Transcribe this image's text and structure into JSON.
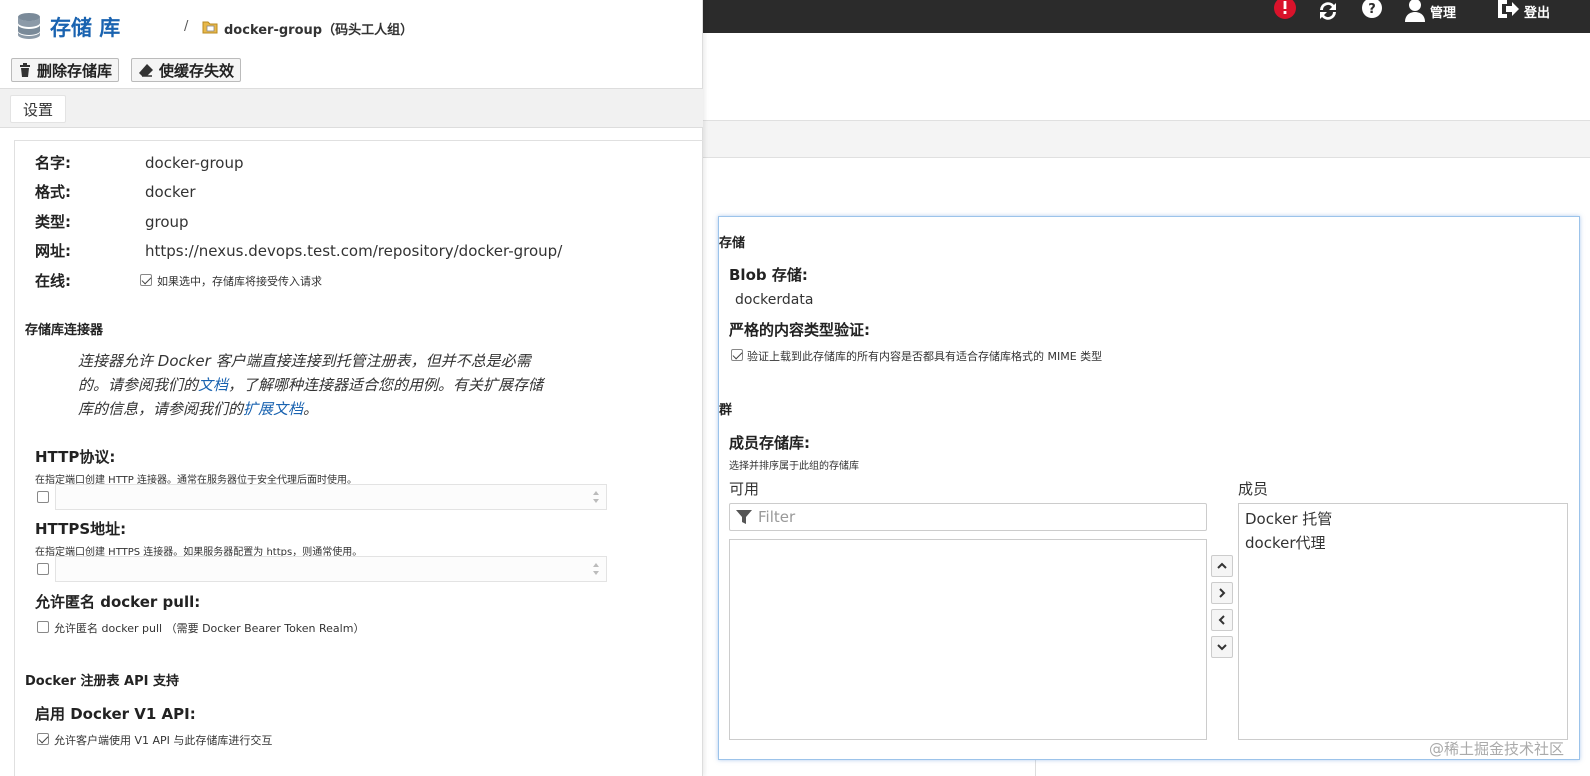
{
  "topbar": {
    "admin_label": "管理",
    "logout_label": "登出"
  },
  "header": {
    "app_title": "存储 库",
    "separator": "/",
    "repo_breadcrumb": "docker-group（码头工人组）"
  },
  "toolbar": {
    "delete_label": "删除存储库",
    "invalidate_label": "使缓存失效"
  },
  "tabs": {
    "settings": "设置"
  },
  "settings": {
    "name_label": "名字:",
    "name_value": "docker-group",
    "format_label": "格式:",
    "format_value": "docker",
    "type_label": "类型:",
    "type_value": "group",
    "url_label": "网址:",
    "url_value": "https://nexus.devops.test.com/repository/docker-group/",
    "online_label": "在线:",
    "online_checked": true,
    "online_text": "如果选中，存储库将接受传入请求"
  },
  "connectors": {
    "title": "存储库连接器",
    "para_1": "连接器允许 Docker 客户端直接连接到托管注册表，但并不总是必需的。请参阅我们的",
    "link_docs": "文档",
    "para_2": "，了解哪种连接器适合您的用例。有关扩展存储库的信息，请参阅我们的",
    "link_ext_docs": "扩展文档",
    "para_3": "。",
    "http_label": "HTTP协议:",
    "http_help": "在指定端口创建 HTTP 连接器。通常在服务器位于安全代理后面时使用。",
    "http_checked": false,
    "https_label": "HTTPS地址:",
    "https_help": "在指定端口创建 HTTPS 连接器。如果服务器配置为 https，则通常使用。",
    "https_checked": false,
    "anon_label": "允许匿名 docker pull:",
    "anon_checked": false,
    "anon_text": "允许匿名 docker pull （需要 Docker Bearer Token Realm）"
  },
  "registry_api": {
    "title": "Docker 注册表 API 支持",
    "v1_label": "启用 Docker V1 API:",
    "v1_checked": true,
    "v1_text": "允许客户端使用 V1 API 与此存储库进行交互"
  },
  "storage": {
    "title": "存储",
    "blob_label": "Blob 存储:",
    "blob_value": "dockerdata",
    "strict_label": "严格的内容类型验证:",
    "strict_checked": true,
    "strict_text": "验证上载到此存储库的所有内容是否都具有适合存储库格式的 MIME 类型"
  },
  "group": {
    "title": "群",
    "members_label": "成员存储库:",
    "members_help": "选择并排序属于此组的存储库",
    "available_label": "可用",
    "members_col_label": "成员",
    "filter_placeholder": "Filter",
    "available": [],
    "members": [
      "Docker 托管",
      "docker代理"
    ]
  },
  "watermark": "@稀土掘金技术社区",
  "colors": {
    "topbar_bg": "#2b2b2b",
    "alert_red": "#d9132b",
    "link_blue": "#1a63b0",
    "title_blue": "#1a63b0"
  }
}
